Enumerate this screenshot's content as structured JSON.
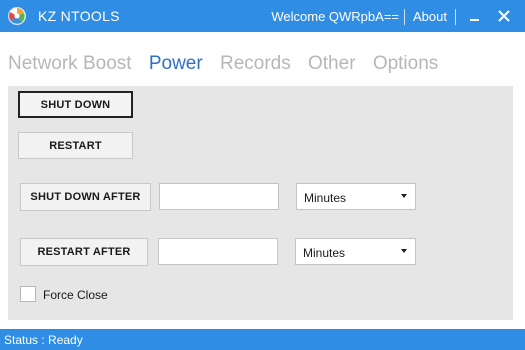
{
  "app": {
    "title": "KZ NTOOLS",
    "welcome": "Welcome QWRpbA==",
    "about": "About",
    "accent": "#2f8de4"
  },
  "tabs": [
    {
      "label": "Network Boost",
      "active": false
    },
    {
      "label": "Power",
      "active": true
    },
    {
      "label": "Records",
      "active": false
    },
    {
      "label": "Other",
      "active": false
    },
    {
      "label": "Options",
      "active": false
    }
  ],
  "power": {
    "shutdown_label": "SHUT DOWN",
    "restart_label": "RESTART",
    "shutdown_after_label": "SHUT DOWN AFTER",
    "shutdown_after_value": "",
    "shutdown_after_unit": "Minutes",
    "restart_after_label": "RESTART AFTER",
    "restart_after_value": "",
    "restart_after_unit": "Minutes",
    "force_close_label": "Force Close",
    "force_close_checked": false
  },
  "status": {
    "text": "Status : Ready"
  },
  "icons": {
    "app": "kz-ntools-logo-icon",
    "minimize": "minimize-icon",
    "close": "close-icon",
    "dropdown": "chevron-down-icon"
  }
}
